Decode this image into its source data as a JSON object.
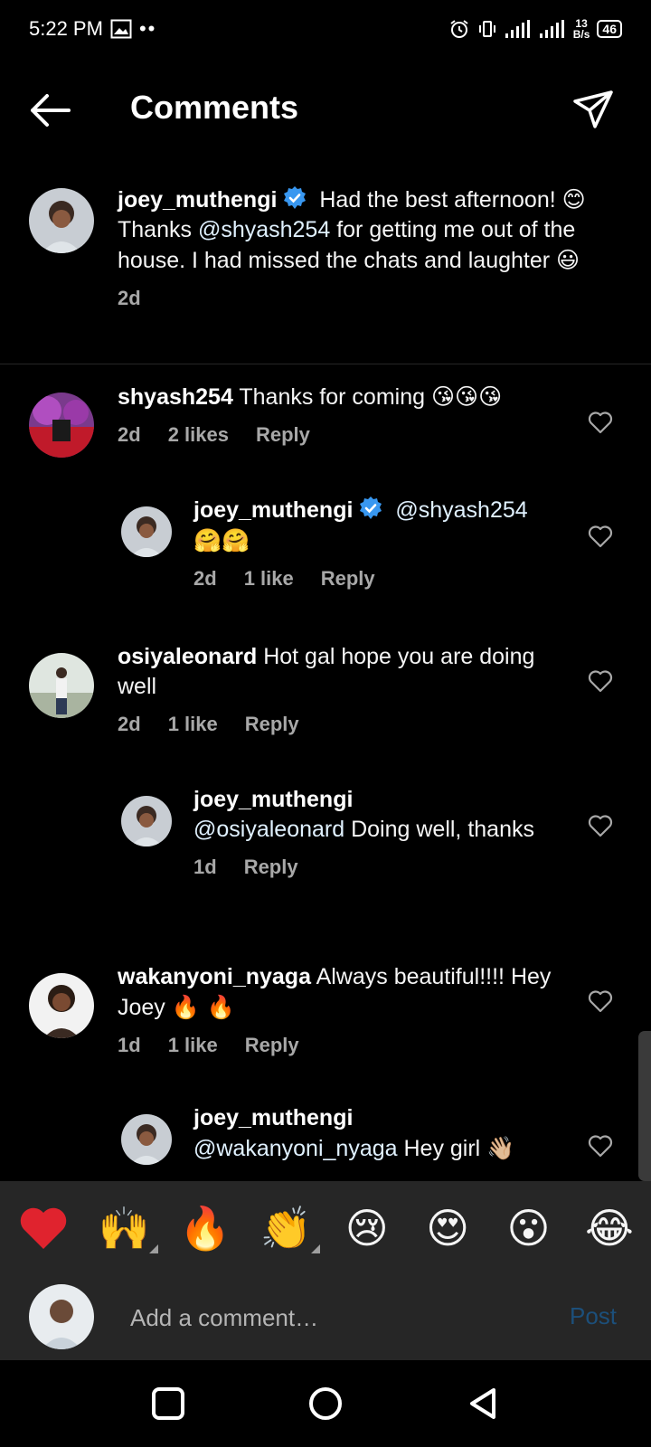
{
  "status_bar": {
    "time": "5:22 PM",
    "dots": "••",
    "net_speed_value": "13",
    "net_speed_unit": "B/s",
    "battery": "46"
  },
  "header": {
    "title": "Comments"
  },
  "caption": {
    "username": "joey_muthengi",
    "text_1": "Had the best afternoon!",
    "emoji_1": "😊",
    "text_2": "Thanks",
    "mention": "@shyash254",
    "text_3": "for getting me out of the house. I had missed the chats and laughter",
    "emoji_2": "😃",
    "time": "2d"
  },
  "comments": [
    {
      "username": "shyash254",
      "text": "Thanks for coming",
      "emoji": "😘😘😘",
      "time": "2d",
      "likes": "2 likes",
      "reply": "Reply"
    },
    {
      "username": "joey_muthengi",
      "mention": "@shyash254",
      "emoji": "🤗🤗",
      "time": "2d",
      "likes": "1 like",
      "reply": "Reply"
    },
    {
      "username": "osiyaleonard",
      "text": "Hot gal hope you are doing well",
      "time": "2d",
      "likes": "1 like",
      "reply": "Reply"
    },
    {
      "username": "joey_muthengi",
      "mention": "@osiyaleonard",
      "text": "Doing well, thanks",
      "time": "1d",
      "reply": "Reply"
    },
    {
      "username": "wakanyoni_nyaga",
      "text": "Always beautiful!!!! Hey Joey",
      "emoji": "🔥 🔥",
      "time": "1d",
      "likes": "1 like",
      "reply": "Reply"
    },
    {
      "username": "joey_muthengi",
      "mention": "@wakanyoni_nyaga",
      "text": "Hey girl",
      "emoji": "👋🏼"
    }
  ],
  "emoji_bar": [
    "❤️",
    "🙌",
    "🔥",
    "👏",
    "😢",
    "😍",
    "😮",
    "😂"
  ],
  "input": {
    "placeholder": "Add a comment…",
    "post_label": "Post"
  },
  "colors": {
    "background": "#000000",
    "panel": "#262626",
    "secondary_text": "#a8a8a8",
    "verified_blue": "#3897f0",
    "post_disabled": "#1c4f7a"
  }
}
